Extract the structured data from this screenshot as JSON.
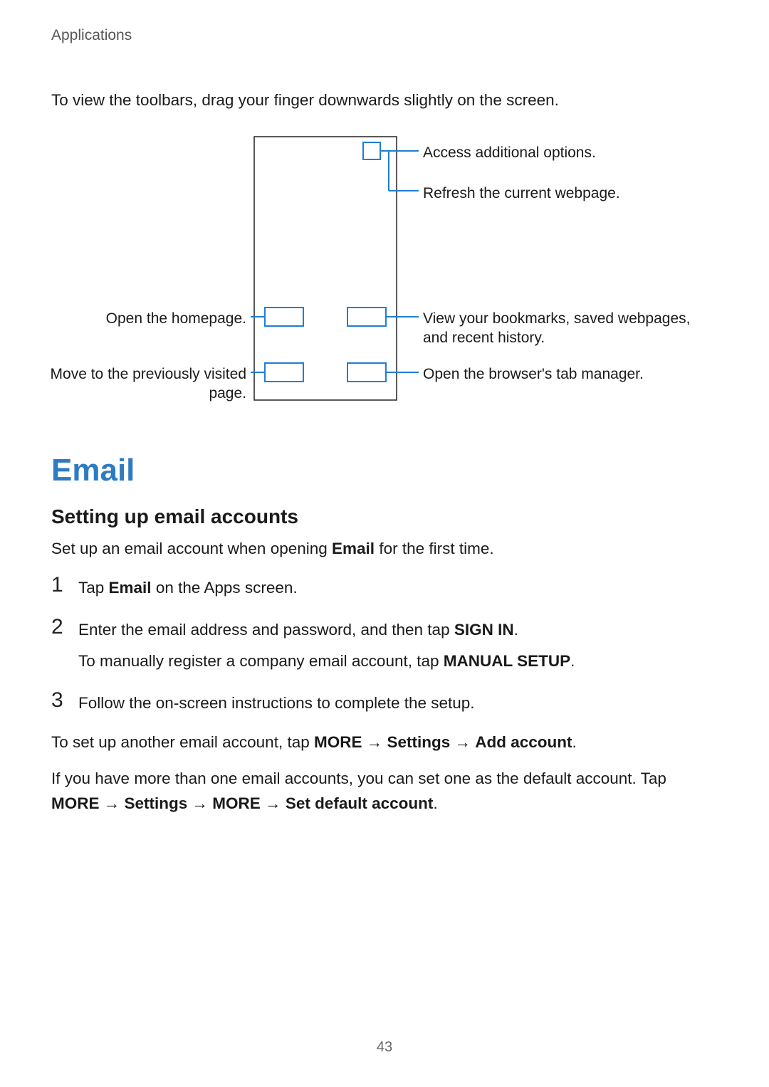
{
  "header": "Applications",
  "intro": "To view the toolbars, drag your finger downwards slightly on the screen.",
  "diagram": {
    "callouts": {
      "options": "Access additional options.",
      "refresh": "Refresh the current webpage.",
      "homepage": "Open the homepage.",
      "bookmarks": "View your bookmarks, saved webpages, and recent history.",
      "back": "Move to the previously visited page.",
      "tabs": "Open the browser's tab manager."
    }
  },
  "section": {
    "title": "Email",
    "subtitle": "Setting up email accounts",
    "lead_pre": "Set up an email account when opening ",
    "lead_bold": "Email",
    "lead_post": " for the first time.",
    "steps": [
      {
        "num": "1",
        "parts": [
          {
            "t": "Tap "
          },
          {
            "t": "Email",
            "b": true
          },
          {
            "t": " on the Apps screen."
          }
        ]
      },
      {
        "num": "2",
        "parts": [
          {
            "t": "Enter the email address and password, and then tap "
          },
          {
            "t": "SIGN IN",
            "b": true
          },
          {
            "t": "."
          }
        ],
        "sub": [
          {
            "t": "To manually register a company email account, tap "
          },
          {
            "t": "MANUAL SETUP",
            "b": true
          },
          {
            "t": "."
          }
        ]
      },
      {
        "num": "3",
        "parts": [
          {
            "t": "Follow the on-screen instructions to complete the setup."
          }
        ]
      }
    ],
    "p1": [
      {
        "t": "To set up another email account, tap "
      },
      {
        "t": "MORE",
        "b": true
      },
      {
        "t": " → "
      },
      {
        "t": "Settings",
        "b": true
      },
      {
        "t": " → "
      },
      {
        "t": "Add account",
        "b": true
      },
      {
        "t": "."
      }
    ],
    "p2": [
      {
        "t": "If you have more than one email accounts, you can set one as the default account. Tap "
      },
      {
        "t": "MORE",
        "b": true
      },
      {
        "t": " → "
      },
      {
        "t": "Settings",
        "b": true
      },
      {
        "t": " → "
      },
      {
        "t": "MORE",
        "b": true
      },
      {
        "t": " → "
      },
      {
        "t": "Set default account",
        "b": true
      },
      {
        "t": "."
      }
    ]
  },
  "page_number": "43"
}
